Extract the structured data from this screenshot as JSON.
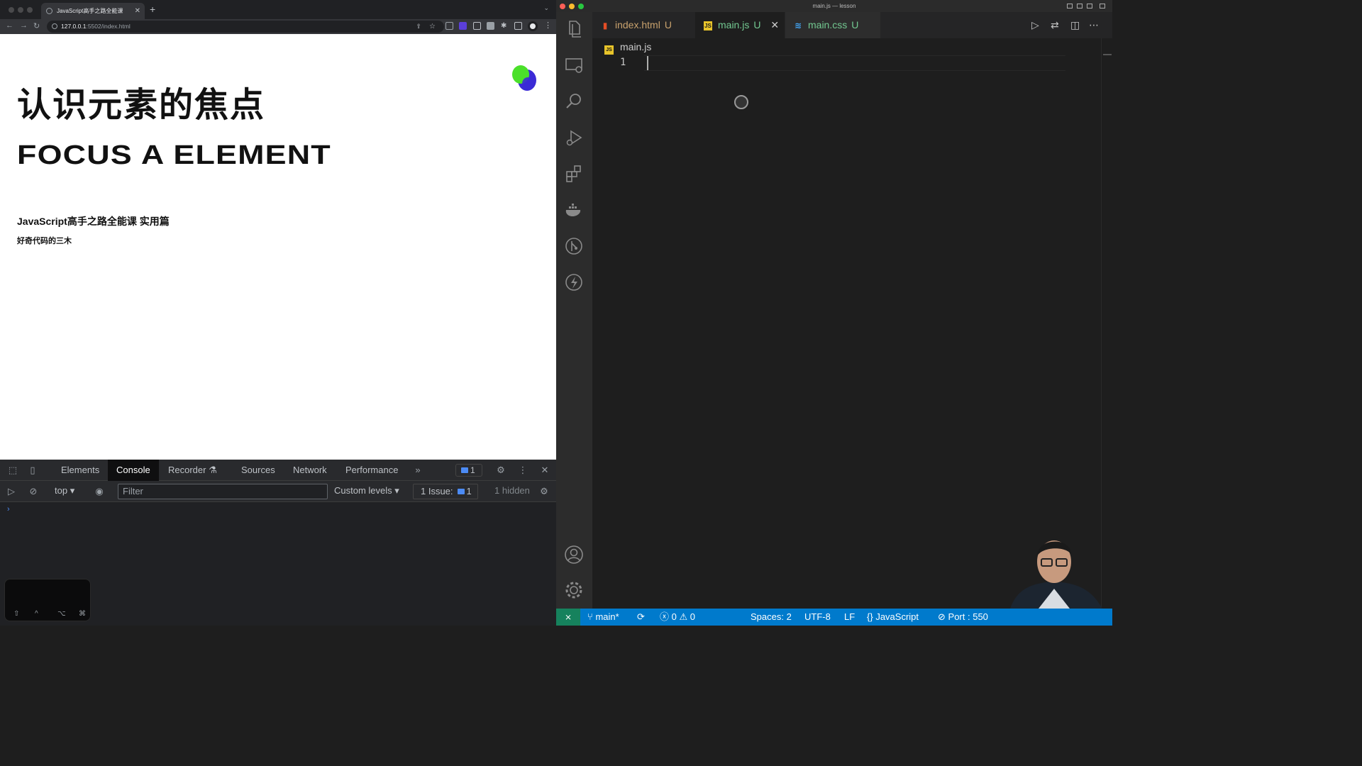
{
  "browser": {
    "tab_title": "JavaScript高手之路全能课",
    "url_host": "127.0.0.1",
    "url_path": ":5502/index.html"
  },
  "page": {
    "heading_cn": "认识元素的焦点",
    "heading_en": "FOCUS A ELEMENT",
    "subtitle": "JavaScript高手之路全能课 实用篇",
    "author": "好奇代码的三木"
  },
  "devtools": {
    "tabs": [
      "Elements",
      "Console",
      "Recorder",
      "Sources",
      "Network",
      "Performance"
    ],
    "active_tab": "Console",
    "issue_badge_count": "1",
    "context": "top",
    "filter_placeholder": "Filter",
    "levels": "Custom levels",
    "issues_label": "1 Issue:",
    "issues_count": "1",
    "hidden": "1 hidden",
    "prompt_symbol": "›"
  },
  "vscode": {
    "window_title": "main.js — lesson",
    "tabs": [
      {
        "label": "index.html",
        "status": "U",
        "color": "#c9a26d",
        "icon_color": "#e44d26"
      },
      {
        "label": "main.js",
        "status": "U",
        "color": "#73c991",
        "icon_color": "#e8c42a"
      },
      {
        "label": "main.css",
        "status": "U",
        "color": "#73c991",
        "icon_color": "#42a5f5"
      }
    ],
    "breadcrumb": "main.js",
    "line_numbers": [
      "1"
    ],
    "status": {
      "branch": "main*",
      "errors": "0",
      "warnings": "0",
      "spaces": "Spaces: 2",
      "encoding": "UTF-8",
      "eol": "LF",
      "language": "JavaScript",
      "port": "Port : 550"
    }
  },
  "colors": {
    "status_bar": "#007acc",
    "remote_indicator": "#16825d",
    "devtools_link": "#4c8bf5"
  }
}
